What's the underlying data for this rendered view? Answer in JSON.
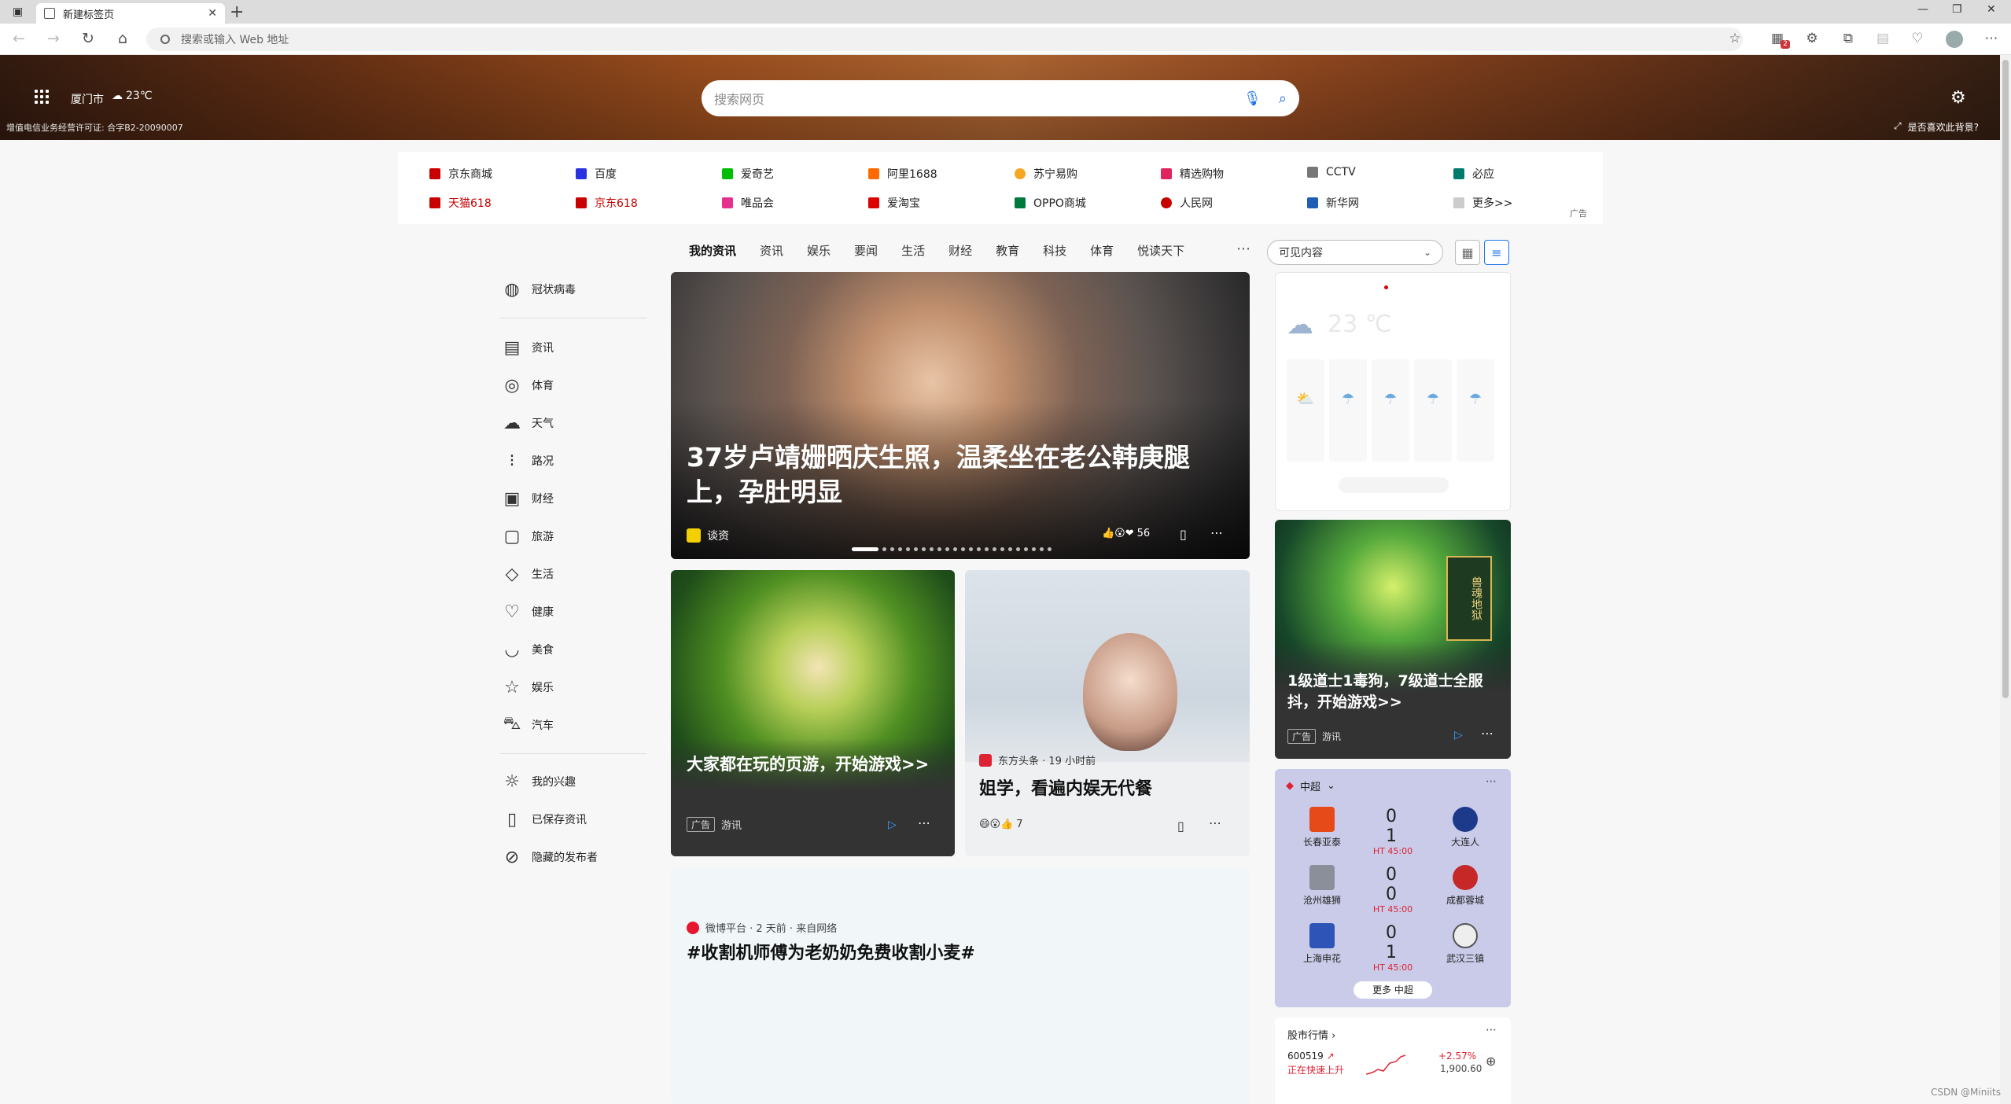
{
  "browser": {
    "tab_title": "新建标签页",
    "address_placeholder": "搜索或输入 Web 地址",
    "notif_count": "2"
  },
  "hero": {
    "city": "厦门市",
    "weather": "23℃",
    "license": "增值电信业务经营许可证: 合字B2-20090007",
    "search_placeholder": "搜索网页",
    "like_bg": "是否喜欢此背景?"
  },
  "quick_links": {
    "row1": [
      "京东商城",
      "百度",
      "爱奇艺",
      "阿里1688",
      "苏宁易购",
      "精选购物",
      "CCTV",
      "必应"
    ],
    "row2": [
      "天猫618",
      "京东618",
      "唯品会",
      "爱淘宝",
      "OPPO商城",
      "人民网",
      "新华网",
      "更多>>"
    ],
    "ad": "广告"
  },
  "feed_nav": {
    "tabs": [
      "我的资讯",
      "资讯",
      "娱乐",
      "要闻",
      "生活",
      "财经",
      "教育",
      "科技",
      "体育",
      "悦读天下"
    ],
    "visible": "可见内容"
  },
  "sidebar": {
    "top": "冠状病毒",
    "items": [
      "资讯",
      "体育",
      "天气",
      "路况",
      "财经",
      "旅游",
      "生活",
      "健康",
      "美食",
      "娱乐",
      "汽车"
    ],
    "bottom": [
      "我的兴趣",
      "已保存资讯",
      "隐藏的发布者"
    ]
  },
  "hero_card": {
    "title": "37岁卢靖姗晒庆生照，温柔坐在老公韩庚腿上，孕肚明显",
    "source": "谈资",
    "reacts": "56"
  },
  "game_card": {
    "title": "大家都在玩的页游，开始游戏>>",
    "tag": "广告",
    "source": "游讯"
  },
  "ent_card": {
    "source": "东方头条 · 19 小时前",
    "title": "姐学，看遍内娱无代餐",
    "reacts": "7"
  },
  "weibo_card": {
    "source": "微博平台 · 2 天前 · 来自网络",
    "title": "#收割机师傅为老奶奶免费收割小麦#"
  },
  "weather_card": {
    "temp": "23 ℃"
  },
  "ad_card": {
    "panel": "兽魂地狱",
    "title": "1级道士1毒狗，7级道士全服抖，开始游戏>>",
    "tag": "广告",
    "source": "游讯"
  },
  "score_card": {
    "league": "中超",
    "matches": [
      {
        "home": "长春亚泰",
        "away": "大连人",
        "score": "0 1",
        "time": "HT 45:00"
      },
      {
        "home": "沧州雄狮",
        "away": "成都蓉城",
        "score": "0 0",
        "time": "HT 45:00"
      },
      {
        "home": "上海申花",
        "away": "武汉三镇",
        "score": "0 1",
        "time": "HT 45:00"
      }
    ],
    "more": "更多 中超"
  },
  "stock_card": {
    "title": "股市行情",
    "code": "600519",
    "status": "正在快速上升",
    "change": "+2.57%",
    "price": "1,900.60"
  },
  "watermark": "CSDN @Miniits"
}
